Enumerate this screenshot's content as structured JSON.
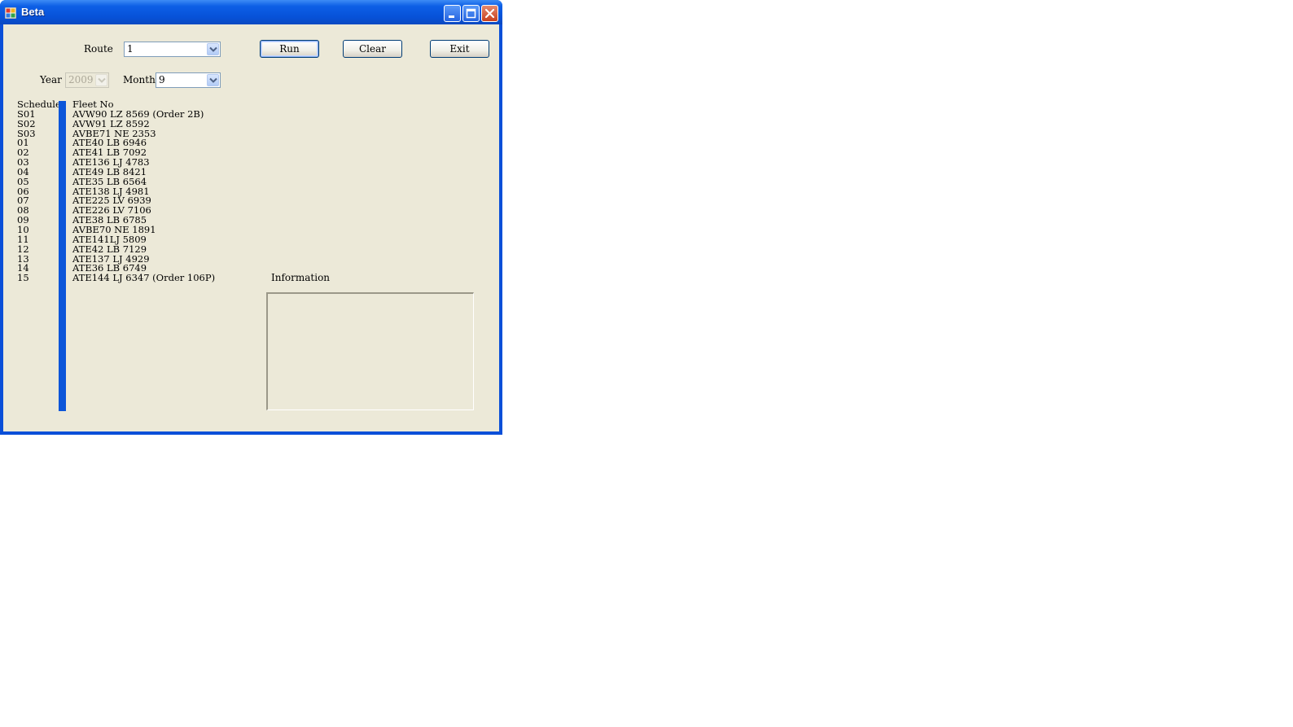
{
  "window": {
    "title": "Beta"
  },
  "form": {
    "route_label": "Route",
    "route_value": "1",
    "year_label": "Year",
    "year_value": "2009",
    "month_label": "Month",
    "month_value": "9",
    "run_label": "Run",
    "clear_label": "Clear",
    "exit_label": "Exit",
    "info_label": "Information",
    "accent_color": "#0b55d9"
  },
  "list": {
    "schedule_header": "Schedule",
    "fleet_header": "Fleet No",
    "schedules": [
      "S01",
      "S02",
      "S03",
      "01",
      "02",
      "03",
      "04",
      "05",
      "06",
      "07",
      "08",
      "09",
      "10",
      "11",
      "12",
      "13",
      "14",
      "15"
    ],
    "fleets": [
      "AVW90 LZ 8569 (Order 2B)",
      "AVW91 LZ 8592",
      "AVBE71 NE 2353",
      "ATE40 LB 6946",
      "ATE41 LB 7092",
      "ATE136 LJ 4783",
      "ATE49 LB 8421",
      "ATE35 LB 6564",
      "ATE138 LJ 4981",
      "ATE225 LV 6939",
      "ATE226 LV 7106",
      "ATE38 LB 6785",
      "AVBE70 NE 1891",
      "ATE141LJ 5809",
      "ATE42 LB 7129",
      "ATE137 LJ 4929",
      "ATE36 LB 6749",
      "ATE144 LJ 6347 (Order 106P)"
    ]
  }
}
